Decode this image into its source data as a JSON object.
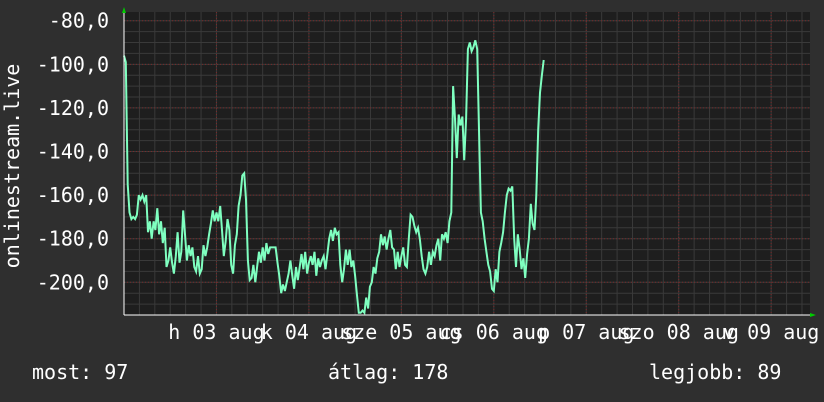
{
  "chart_data": {
    "type": "line",
    "ylabel": "onlinestream.live",
    "ylim": [
      -215,
      -76
    ],
    "y_ticks": [
      -80,
      -100,
      -120,
      -140,
      -160,
      -180,
      -200
    ],
    "y_tick_labels": [
      "-80,0",
      "-100,0",
      "-120,0",
      "-140,0",
      "-160,0",
      "-180,0",
      "-200,0"
    ],
    "x_ticks": [
      {
        "label": "h 03 aug",
        "x": 1.0
      },
      {
        "label": "k 04 aug",
        "x": 2.0
      },
      {
        "label": "sze 05 aug",
        "x": 3.0
      },
      {
        "label": "cs 06 aug",
        "x": 4.0
      },
      {
        "label": "p 07 aug",
        "x": 5.0
      },
      {
        "label": "szo 08 aug",
        "x": 6.0
      },
      {
        "label": "v 09 aug",
        "x": 7.0
      }
    ],
    "xlim": [
      0.0,
      7.42
    ],
    "series": [
      {
        "color": "#7fffc0",
        "points": [
          [
            0.0,
            -96
          ],
          [
            0.02,
            -99
          ],
          [
            0.04,
            -155
          ],
          [
            0.06,
            -168
          ],
          [
            0.08,
            -171
          ],
          [
            0.1,
            -170
          ],
          [
            0.12,
            -171
          ],
          [
            0.14,
            -169
          ],
          [
            0.16,
            -160
          ],
          [
            0.18,
            -162
          ],
          [
            0.2,
            -160
          ],
          [
            0.22,
            -163
          ],
          [
            0.24,
            -160
          ],
          [
            0.26,
            -177
          ],
          [
            0.28,
            -172
          ],
          [
            0.3,
            -180
          ],
          [
            0.32,
            -172
          ],
          [
            0.34,
            -176
          ],
          [
            0.36,
            -166
          ],
          [
            0.38,
            -178
          ],
          [
            0.4,
            -172
          ],
          [
            0.42,
            -182
          ],
          [
            0.44,
            -175
          ],
          [
            0.46,
            -193
          ],
          [
            0.48,
            -190
          ],
          [
            0.5,
            -184
          ],
          [
            0.52,
            -191
          ],
          [
            0.54,
            -196
          ],
          [
            0.56,
            -188
          ],
          [
            0.58,
            -177
          ],
          [
            0.6,
            -191
          ],
          [
            0.62,
            -186
          ],
          [
            0.64,
            -167
          ],
          [
            0.66,
            -178
          ],
          [
            0.68,
            -190
          ],
          [
            0.7,
            -183
          ],
          [
            0.72,
            -188
          ],
          [
            0.74,
            -184
          ],
          [
            0.76,
            -193
          ],
          [
            0.78,
            -195
          ],
          [
            0.8,
            -188
          ],
          [
            0.82,
            -196
          ],
          [
            0.84,
            -194
          ],
          [
            0.86,
            -183
          ],
          [
            0.88,
            -188
          ],
          [
            0.9,
            -184
          ],
          [
            0.92,
            -178
          ],
          [
            0.94,
            -173
          ],
          [
            0.96,
            -167
          ],
          [
            0.98,
            -172
          ],
          [
            1.0,
            -168
          ],
          [
            1.02,
            -172
          ],
          [
            1.04,
            -165
          ],
          [
            1.06,
            -176
          ],
          [
            1.08,
            -188
          ],
          [
            1.1,
            -181
          ],
          [
            1.12,
            -171
          ],
          [
            1.14,
            -176
          ],
          [
            1.16,
            -192
          ],
          [
            1.18,
            -196
          ],
          [
            1.2,
            -183
          ],
          [
            1.22,
            -178
          ],
          [
            1.24,
            -165
          ],
          [
            1.26,
            -160
          ],
          [
            1.28,
            -151
          ],
          [
            1.3,
            -150
          ],
          [
            1.32,
            -162
          ],
          [
            1.34,
            -190
          ],
          [
            1.36,
            -199
          ],
          [
            1.38,
            -198
          ],
          [
            1.4,
            -192
          ],
          [
            1.42,
            -200
          ],
          [
            1.44,
            -193
          ],
          [
            1.46,
            -186
          ],
          [
            1.48,
            -191
          ],
          [
            1.5,
            -184
          ],
          [
            1.52,
            -190
          ],
          [
            1.54,
            -182
          ],
          [
            1.56,
            -187
          ],
          [
            1.58,
            -184
          ],
          [
            1.6,
            -184
          ],
          [
            1.62,
            -184
          ],
          [
            1.64,
            -184
          ],
          [
            1.66,
            -191
          ],
          [
            1.68,
            -197
          ],
          [
            1.7,
            -205
          ],
          [
            1.72,
            -201
          ],
          [
            1.74,
            -204
          ],
          [
            1.76,
            -200
          ],
          [
            1.78,
            -196
          ],
          [
            1.8,
            -190
          ],
          [
            1.82,
            -197
          ],
          [
            1.84,
            -203
          ],
          [
            1.86,
            -193
          ],
          [
            1.88,
            -199
          ],
          [
            1.9,
            -193
          ],
          [
            1.92,
            -187
          ],
          [
            1.94,
            -194
          ],
          [
            1.96,
            -186
          ],
          [
            1.98,
            -196
          ],
          [
            2.0,
            -191
          ],
          [
            2.02,
            -188
          ],
          [
            2.04,
            -192
          ],
          [
            2.06,
            -186
          ],
          [
            2.08,
            -197
          ],
          [
            2.1,
            -189
          ],
          [
            2.12,
            -193
          ],
          [
            2.14,
            -190
          ],
          [
            2.16,
            -188
          ],
          [
            2.18,
            -194
          ],
          [
            2.2,
            -187
          ],
          [
            2.22,
            -180
          ],
          [
            2.24,
            -176
          ],
          [
            2.26,
            -181
          ],
          [
            2.28,
            -175
          ],
          [
            2.3,
            -178
          ],
          [
            2.32,
            -177
          ],
          [
            2.34,
            -192
          ],
          [
            2.36,
            -200
          ],
          [
            2.38,
            -194
          ],
          [
            2.4,
            -185
          ],
          [
            2.42,
            -192
          ],
          [
            2.44,
            -185
          ],
          [
            2.46,
            -193
          ],
          [
            2.48,
            -190
          ],
          [
            2.5,
            -197
          ],
          [
            2.52,
            -206
          ],
          [
            2.54,
            -214
          ],
          [
            2.56,
            -214
          ],
          [
            2.58,
            -213
          ],
          [
            2.6,
            -214
          ],
          [
            2.62,
            -207
          ],
          [
            2.64,
            -212
          ],
          [
            2.66,
            -202
          ],
          [
            2.68,
            -200
          ],
          [
            2.7,
            -193
          ],
          [
            2.72,
            -196
          ],
          [
            2.74,
            -189
          ],
          [
            2.76,
            -186
          ],
          [
            2.78,
            -178
          ],
          [
            2.8,
            -183
          ],
          [
            2.82,
            -179
          ],
          [
            2.84,
            -185
          ],
          [
            2.86,
            -180
          ],
          [
            2.88,
            -176
          ],
          [
            2.9,
            -184
          ],
          [
            2.92,
            -185
          ],
          [
            2.94,
            -194
          ],
          [
            2.96,
            -186
          ],
          [
            2.98,
            -193
          ],
          [
            3.0,
            -188
          ],
          [
            3.02,
            -184
          ],
          [
            3.04,
            -192
          ],
          [
            3.06,
            -193
          ],
          [
            3.08,
            -180
          ],
          [
            3.1,
            -169
          ],
          [
            3.12,
            -170
          ],
          [
            3.14,
            -174
          ],
          [
            3.16,
            -177
          ],
          [
            3.18,
            -175
          ],
          [
            3.2,
            -180
          ],
          [
            3.22,
            -188
          ],
          [
            3.24,
            -194
          ],
          [
            3.26,
            -196
          ],
          [
            3.28,
            -193
          ],
          [
            3.3,
            -186
          ],
          [
            3.32,
            -192
          ],
          [
            3.34,
            -186
          ],
          [
            3.36,
            -188
          ],
          [
            3.38,
            -183
          ],
          [
            3.4,
            -180
          ],
          [
            3.42,
            -190
          ],
          [
            3.44,
            -178
          ],
          [
            3.46,
            -180
          ],
          [
            3.48,
            -177
          ],
          [
            3.5,
            -182
          ],
          [
            3.52,
            -172
          ],
          [
            3.54,
            -168
          ],
          [
            3.56,
            -110
          ],
          [
            3.58,
            -125
          ],
          [
            3.6,
            -143
          ],
          [
            3.62,
            -123
          ],
          [
            3.64,
            -128
          ],
          [
            3.66,
            -124
          ],
          [
            3.68,
            -144
          ],
          [
            3.7,
            -125
          ],
          [
            3.72,
            -93
          ],
          [
            3.74,
            -90
          ],
          [
            3.76,
            -94
          ],
          [
            3.78,
            -92
          ],
          [
            3.8,
            -89
          ],
          [
            3.82,
            -93
          ],
          [
            3.84,
            -130
          ],
          [
            3.86,
            -168
          ],
          [
            3.88,
            -172
          ],
          [
            3.9,
            -180
          ],
          [
            3.92,
            -186
          ],
          [
            3.94,
            -192
          ],
          [
            3.96,
            -195
          ],
          [
            3.98,
            -203
          ],
          [
            4.0,
            -204
          ],
          [
            4.02,
            -194
          ],
          [
            4.04,
            -200
          ],
          [
            4.06,
            -186
          ],
          [
            4.08,
            -182
          ],
          [
            4.1,
            -177
          ],
          [
            4.12,
            -168
          ],
          [
            4.14,
            -160
          ],
          [
            4.16,
            -157
          ],
          [
            4.18,
            -158
          ],
          [
            4.2,
            -156
          ],
          [
            4.22,
            -180
          ],
          [
            4.24,
            -193
          ],
          [
            4.26,
            -178
          ],
          [
            4.28,
            -185
          ],
          [
            4.3,
            -194
          ],
          [
            4.32,
            -189
          ],
          [
            4.34,
            -198
          ],
          [
            4.36,
            -187
          ],
          [
            4.38,
            -180
          ],
          [
            4.4,
            -164
          ],
          [
            4.42,
            -173
          ],
          [
            4.44,
            -176
          ],
          [
            4.46,
            -160
          ],
          [
            4.48,
            -130
          ],
          [
            4.5,
            -113
          ],
          [
            4.52,
            -105
          ],
          [
            4.54,
            -98
          ]
        ]
      }
    ],
    "grid": true
  },
  "stats": {
    "now": "most: 97",
    "avg": "átlag: 178",
    "best": "legjobb: 89"
  }
}
